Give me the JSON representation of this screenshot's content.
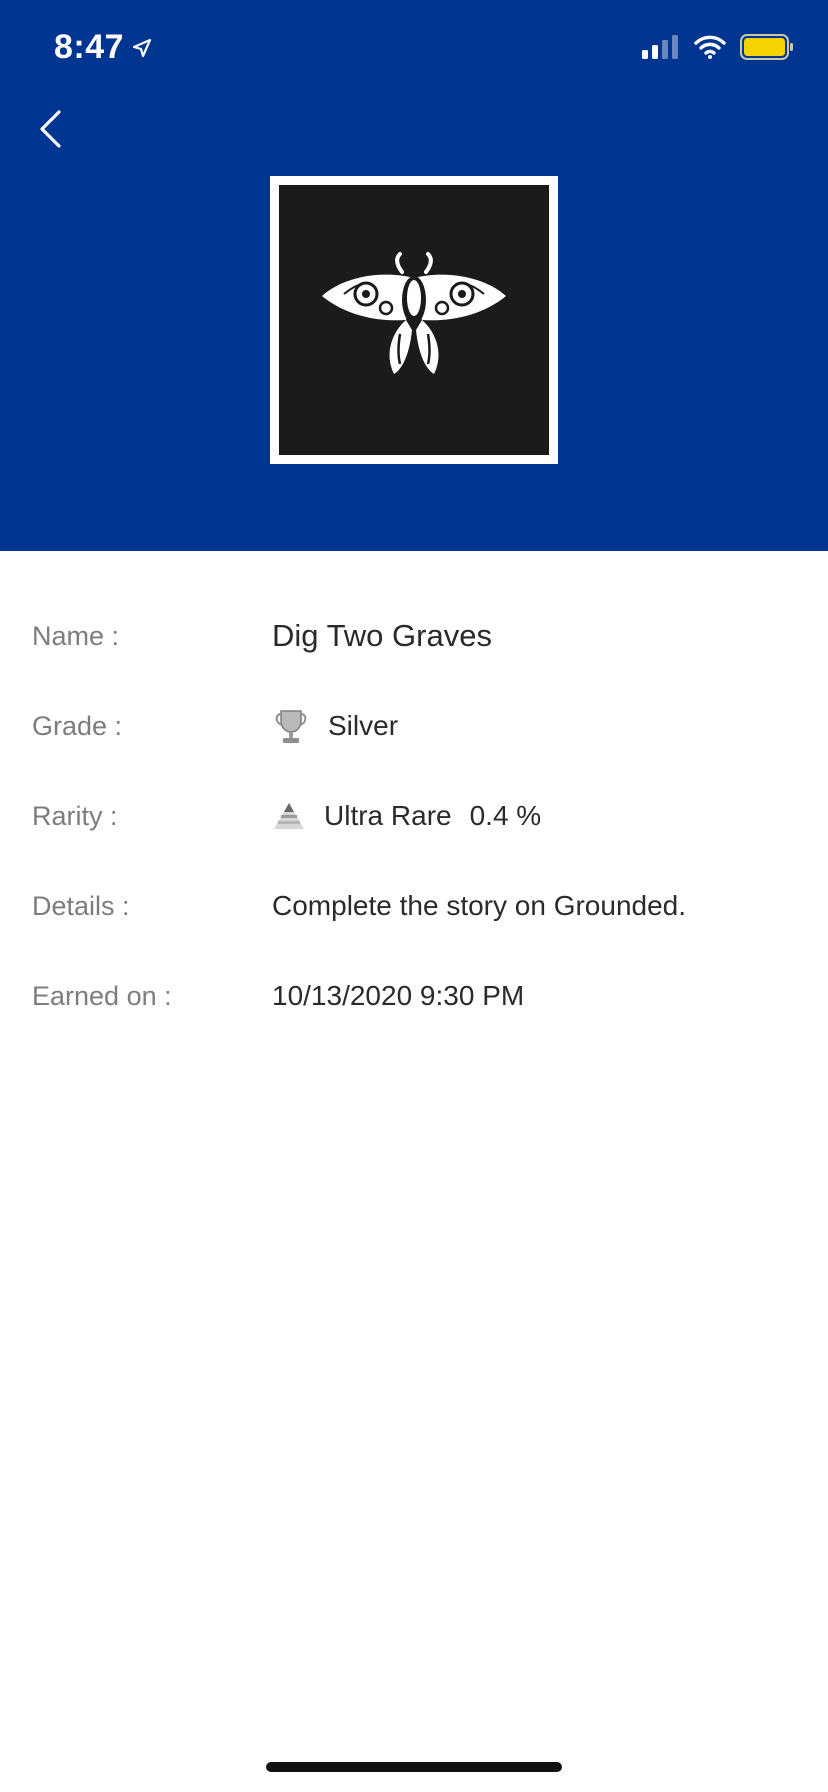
{
  "status_bar": {
    "time": "8:47",
    "location_icon": "location-arrow-icon",
    "signal_icon": "cellular-signal-icon",
    "wifi_icon": "wifi-icon",
    "battery_icon": "battery-icon",
    "battery_color": "#F5D200"
  },
  "header": {
    "background_color": "#003591",
    "back_icon": "chevron-left-icon",
    "trophy_image": "moth-emblem-image"
  },
  "details": {
    "name": {
      "label": "Name :",
      "value": "Dig Two Graves"
    },
    "grade": {
      "label": "Grade :",
      "icon": "silver-trophy-icon",
      "value": "Silver"
    },
    "rarity": {
      "label": "Rarity :",
      "icon": "rarity-pyramid-icon",
      "value": "Ultra Rare",
      "percent": "0.4 %"
    },
    "description": {
      "label": "Details :",
      "value": "Complete the story on Grounded."
    },
    "earned": {
      "label": "Earned on :",
      "value": "10/13/2020 9:30 PM"
    }
  }
}
